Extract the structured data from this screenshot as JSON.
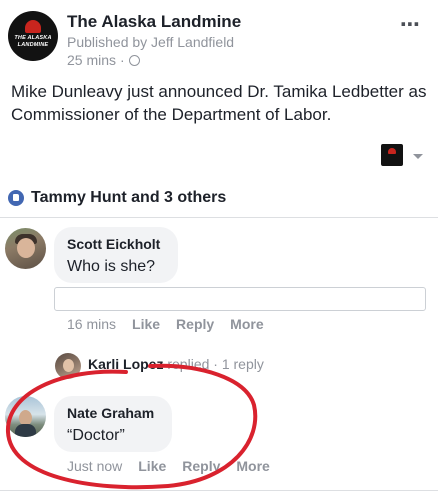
{
  "post": {
    "page_name": "The Alaska Landmine",
    "logo_text": "THE ALASKA\nLANDMINE",
    "published_by": "Published by Jeff Landfield",
    "timestamp": "25 mins",
    "separator": "·",
    "body": "Mike Dunleavy just announced Dr. Tamika Ledbetter as Commissioner of the Department of Labor.",
    "more_icon": "⋯",
    "brand_color": "#c8251e"
  },
  "reactions": {
    "summary": "Tammy Hunt and 3 others",
    "icon": "like-icon",
    "color": "#4267b2"
  },
  "comments": [
    {
      "author": "Scott Eickholt",
      "text": "Who is she?",
      "time": "16 mins",
      "actions": [
        "Like",
        "Reply",
        "More"
      ],
      "reply_summary": {
        "name": "Karli Lopez",
        "verb": "replied",
        "count": "1 reply",
        "separator": "·"
      }
    },
    {
      "author": "Nate Graham",
      "text": "“Doctor”",
      "time": "Just now",
      "actions": [
        "Like",
        "Reply",
        "More"
      ]
    }
  ],
  "annotation_color": "#d9222e"
}
